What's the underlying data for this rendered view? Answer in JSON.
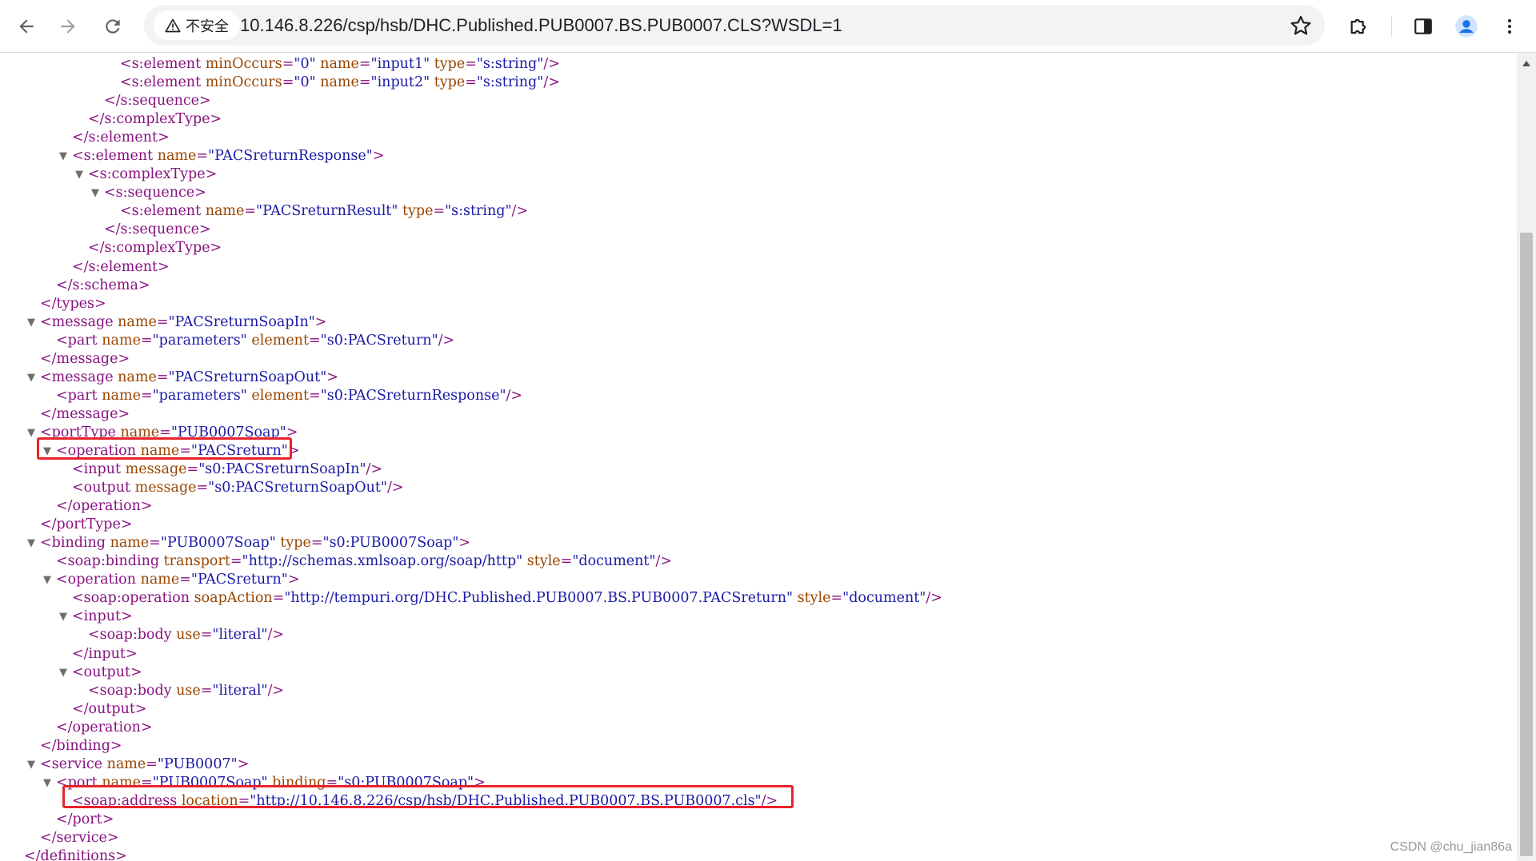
{
  "browser": {
    "security_label": "不安全",
    "url": "10.146.8.226/csp/hsb/DHC.Published.PUB0007.BS.PUB0007.CLS?WSDL=1",
    "icons": {
      "back": "back-arrow-icon",
      "forward": "forward-arrow-icon",
      "reload": "reload-icon",
      "warning": "warning-triangle-icon",
      "bookmark": "bookmark-star-icon",
      "extensions": "puzzle-extensions-icon",
      "side_panel": "side-panel-icon",
      "profile": "profile-avatar-icon",
      "menu": "kebab-menu-icon"
    },
    "accent_color": "#1a73e8"
  },
  "xml": {
    "lines": [
      {
        "indent": 7,
        "fold": false,
        "text": "<s:element minOccurs=\"0\" name=\"input1\" type=\"s:string\"/>"
      },
      {
        "indent": 7,
        "fold": false,
        "text": "<s:element minOccurs=\"0\" name=\"input2\" type=\"s:string\"/>"
      },
      {
        "indent": 6,
        "fold": false,
        "text": "</s:sequence>"
      },
      {
        "indent": 5,
        "fold": false,
        "text": "</s:complexType>"
      },
      {
        "indent": 4,
        "fold": false,
        "text": "</s:element>"
      },
      {
        "indent": 4,
        "fold": true,
        "text": "<s:element name=\"PACSreturnResponse\">"
      },
      {
        "indent": 5,
        "fold": true,
        "text": "<s:complexType>"
      },
      {
        "indent": 6,
        "fold": true,
        "text": "<s:sequence>"
      },
      {
        "indent": 7,
        "fold": false,
        "text": "<s:element name=\"PACSreturnResult\" type=\"s:string\"/>"
      },
      {
        "indent": 6,
        "fold": false,
        "text": "</s:sequence>"
      },
      {
        "indent": 5,
        "fold": false,
        "text": "</s:complexType>"
      },
      {
        "indent": 4,
        "fold": false,
        "text": "</s:element>"
      },
      {
        "indent": 3,
        "fold": false,
        "text": "</s:schema>"
      },
      {
        "indent": 2,
        "fold": false,
        "text": "</types>"
      },
      {
        "indent": 2,
        "fold": true,
        "text": "<message name=\"PACSreturnSoapIn\">"
      },
      {
        "indent": 3,
        "fold": false,
        "text": "<part name=\"parameters\" element=\"s0:PACSreturn\"/>"
      },
      {
        "indent": 2,
        "fold": false,
        "text": "</message>"
      },
      {
        "indent": 2,
        "fold": true,
        "text": "<message name=\"PACSreturnSoapOut\">"
      },
      {
        "indent": 3,
        "fold": false,
        "text": "<part name=\"parameters\" element=\"s0:PACSreturnResponse\"/>"
      },
      {
        "indent": 2,
        "fold": false,
        "text": "</message>"
      },
      {
        "indent": 2,
        "fold": true,
        "text": "<portType name=\"PUB0007Soap\">"
      },
      {
        "indent": 3,
        "fold": true,
        "text": "<operation name=\"PACSreturn\">"
      },
      {
        "indent": 4,
        "fold": false,
        "text": "<input message=\"s0:PACSreturnSoapIn\"/>"
      },
      {
        "indent": 4,
        "fold": false,
        "text": "<output message=\"s0:PACSreturnSoapOut\"/>"
      },
      {
        "indent": 3,
        "fold": false,
        "text": "</operation>"
      },
      {
        "indent": 2,
        "fold": false,
        "text": "</portType>"
      },
      {
        "indent": 2,
        "fold": true,
        "text": "<binding name=\"PUB0007Soap\" type=\"s0:PUB0007Soap\">"
      },
      {
        "indent": 3,
        "fold": false,
        "text": "<soap:binding transport=\"http://schemas.xmlsoap.org/soap/http\" style=\"document\"/>"
      },
      {
        "indent": 3,
        "fold": true,
        "text": "<operation name=\"PACSreturn\">"
      },
      {
        "indent": 4,
        "fold": false,
        "text": "<soap:operation soapAction=\"http://tempuri.org/DHC.Published.PUB0007.BS.PUB0007.PACSreturn\" style=\"document\"/>"
      },
      {
        "indent": 4,
        "fold": true,
        "text": "<input>"
      },
      {
        "indent": 5,
        "fold": false,
        "text": "<soap:body use=\"literal\"/>"
      },
      {
        "indent": 4,
        "fold": false,
        "text": "</input>"
      },
      {
        "indent": 4,
        "fold": true,
        "text": "<output>"
      },
      {
        "indent": 5,
        "fold": false,
        "text": "<soap:body use=\"literal\"/>"
      },
      {
        "indent": 4,
        "fold": false,
        "text": "</output>"
      },
      {
        "indent": 3,
        "fold": false,
        "text": "</operation>"
      },
      {
        "indent": 2,
        "fold": false,
        "text": "</binding>"
      },
      {
        "indent": 2,
        "fold": true,
        "text": "<service name=\"PUB0007\">"
      },
      {
        "indent": 3,
        "fold": true,
        "text": "<port name=\"PUB0007Soap\" binding=\"s0:PUB0007Soap\">"
      },
      {
        "indent": 4,
        "fold": false,
        "text": "<soap:address location=\"http://10.146.8.226/csp/hsb/DHC.Published.PUB0007.BS.PUB0007.cls\"/>"
      },
      {
        "indent": 3,
        "fold": false,
        "text": "</port>"
      },
      {
        "indent": 2,
        "fold": false,
        "text": "</service>"
      },
      {
        "indent": 1,
        "fold": false,
        "text": "</definitions>"
      }
    ],
    "colors": {
      "tag": "#881280",
      "attr_name": "#994500",
      "attr_value": "#1a1aa6",
      "highlight": "#e8232b"
    }
  },
  "watermark": "CSDN @chu_jian86a"
}
